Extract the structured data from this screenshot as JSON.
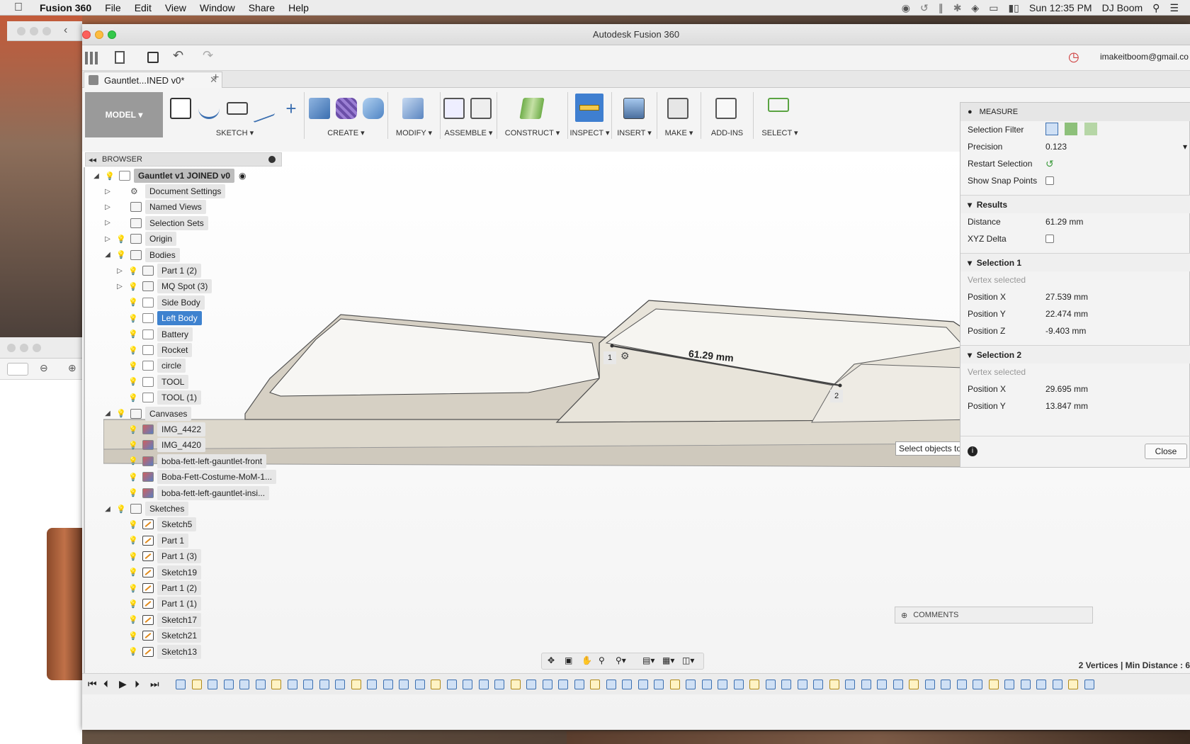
{
  "menubar": {
    "app": "Fusion 360",
    "items": [
      "File",
      "Edit",
      "View",
      "Window",
      "Share",
      "Help"
    ],
    "clock": "Sun 12:35 PM",
    "user": "DJ Boom"
  },
  "window": {
    "title": "Autodesk Fusion 360",
    "account": "imakeitboom@gmail.co",
    "tab_label": "Gauntlet...INED v0*"
  },
  "ribbon": {
    "workspace": "MODEL",
    "groups": [
      "SKETCH",
      "CREATE",
      "MODIFY",
      "ASSEMBLE",
      "CONSTRUCT",
      "INSPECT",
      "INSERT",
      "MAKE",
      "ADD-INS",
      "SELECT"
    ]
  },
  "browser": {
    "title": "BROWSER",
    "root": "Gauntlet v1 JOINED v0",
    "items": [
      {
        "label": "Document Settings"
      },
      {
        "label": "Named Views"
      },
      {
        "label": "Selection Sets"
      },
      {
        "label": "Origin"
      },
      {
        "label": "Bodies"
      },
      {
        "label": "Part 1 (2)"
      },
      {
        "label": "MQ Spot (3)"
      },
      {
        "label": "Side Body"
      },
      {
        "label": "Left Body"
      },
      {
        "label": "Battery"
      },
      {
        "label": "Rocket"
      },
      {
        "label": "circle"
      },
      {
        "label": "TOOL"
      },
      {
        "label": "TOOL (1)"
      },
      {
        "label": "Canvases"
      },
      {
        "label": "IMG_4422"
      },
      {
        "label": "IMG_4420"
      },
      {
        "label": "boba-fett-left-gauntlet-front"
      },
      {
        "label": "Boba-Fett-Costume-MoM-1..."
      },
      {
        "label": "boba-fett-left-gauntlet-insi..."
      },
      {
        "label": "Sketches"
      },
      {
        "label": "Sketch5"
      },
      {
        "label": "Part 1"
      },
      {
        "label": "Part 1 (3)"
      },
      {
        "label": "Sketch19"
      },
      {
        "label": "Part 1 (2)"
      },
      {
        "label": "Part 1 (1)"
      },
      {
        "label": "Sketch17"
      },
      {
        "label": "Sketch21"
      },
      {
        "label": "Sketch13"
      }
    ]
  },
  "viewport": {
    "dimension": "61.29 mm",
    "point1": "1",
    "point2": "2",
    "tooltip": "Select objects to measure. Hold Shift to remove snap",
    "comments": "COMMENTS",
    "status": "2 Vertices | Min Distance : 6"
  },
  "measure": {
    "title": "MEASURE",
    "selection_filter": "Selection Filter",
    "precision_label": "Precision",
    "precision_value": "0.123",
    "restart": "Restart Selection",
    "snap": "Show Snap Points",
    "results": "Results",
    "distance_label": "Distance",
    "distance_value": "61.29 mm",
    "xyz": "XYZ Delta",
    "sel1": "Selection 1",
    "sel1_state": "Vertex selected",
    "pos_x": "Position X",
    "pos_y": "Position Y",
    "pos_z": "Position Z",
    "sel1_x": "27.539 mm",
    "sel1_y": "22.474 mm",
    "sel1_z": "-9.403 mm",
    "sel2": "Selection 2",
    "sel2_state": "Vertex selected",
    "sel2_x": "29.695 mm",
    "sel2_y": "13.847 mm",
    "close": "Close"
  }
}
